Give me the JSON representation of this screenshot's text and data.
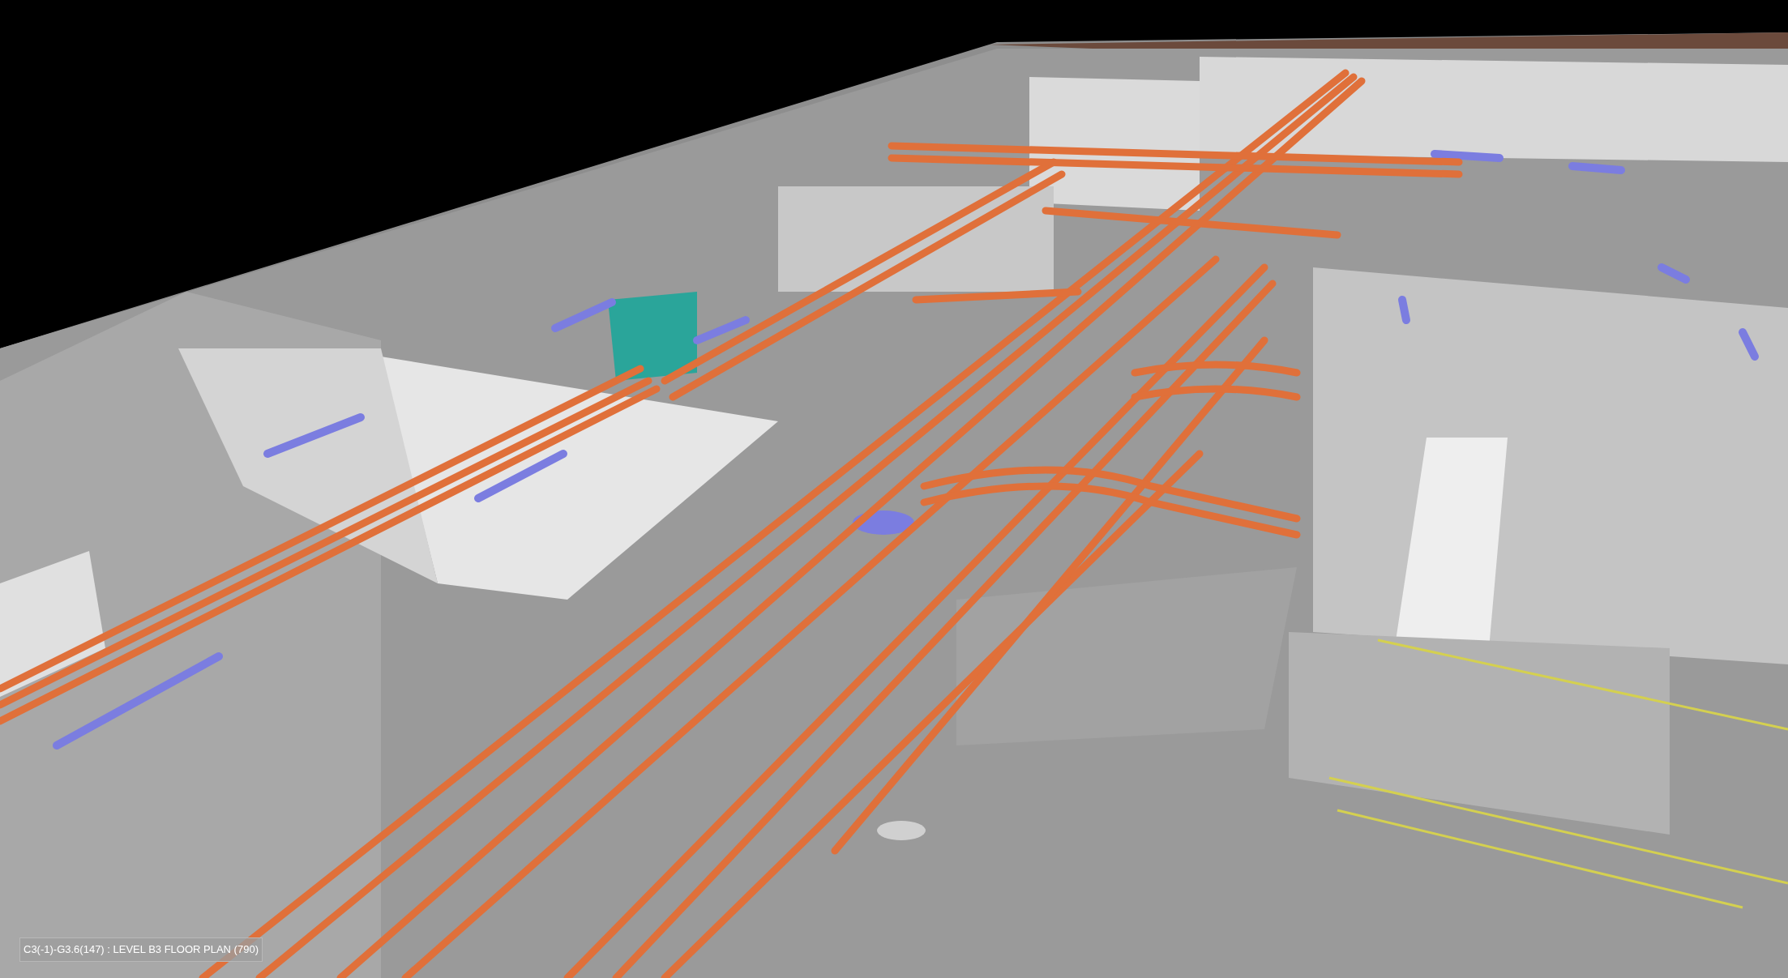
{
  "viewport": {
    "status_label": "C3(-1)-G3.6(147) : LEVEL B3 FLOOR PLAN (790)"
  }
}
